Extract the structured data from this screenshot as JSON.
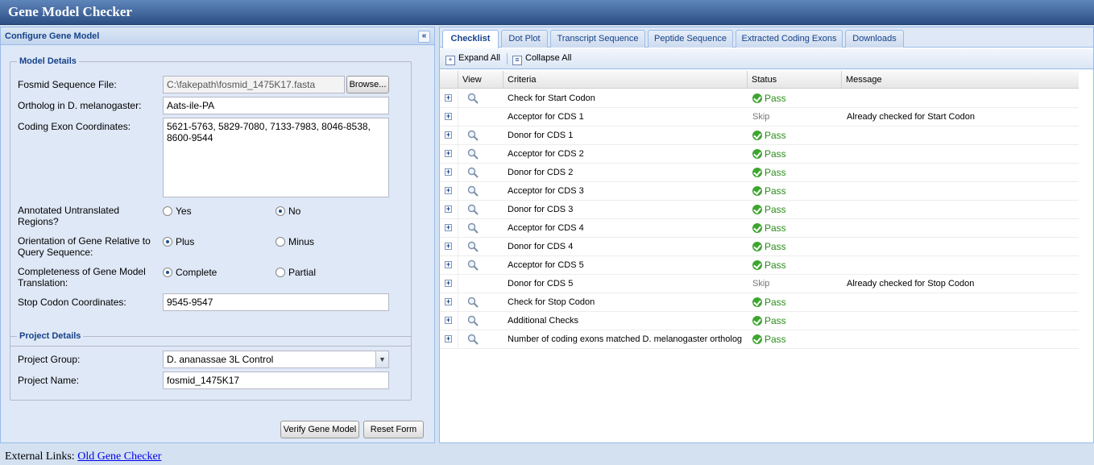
{
  "app": {
    "title": "Gene Model Checker"
  },
  "left": {
    "title": "Configure Gene Model",
    "collapse_glyph": "«",
    "model_details": {
      "legend": "Model Details",
      "fosmid_label": "Fosmid Sequence File:",
      "fosmid_value": "C:\\fakepath\\fosmid_1475K17.fasta",
      "browse_label": "Browse...",
      "ortholog_label": "Ortholog in D. melanogaster:",
      "ortholog_value": "Aats-ile-PA",
      "coords_label": "Coding Exon Coordinates:",
      "coords_value": "5621-5763, 5829-7080, 7133-7983, 8046-8538, 8600-9544",
      "utr_label": "Annotated Untranslated Regions?",
      "utr_yes": "Yes",
      "utr_no": "No",
      "orient_label": "Orientation of Gene Relative to Query Sequence:",
      "orient_plus": "Plus",
      "orient_minus": "Minus",
      "complete_label": "Completeness of Gene Model Translation:",
      "complete_complete": "Complete",
      "complete_partial": "Partial",
      "stop_label": "Stop Codon Coordinates:",
      "stop_value": "9545-9547"
    },
    "project_details": {
      "legend": "Project Details",
      "group_label": "Project Group:",
      "group_value": "D. ananassae 3L Control",
      "name_label": "Project Name:",
      "name_value": "fosmid_1475K17"
    },
    "verify_label": "Verify Gene Model",
    "reset_label": "Reset Form"
  },
  "footer": {
    "prefix": "External Links:",
    "link": "Old Gene Checker"
  },
  "right": {
    "tabs": [
      "Checklist",
      "Dot Plot",
      "Transcript Sequence",
      "Peptide Sequence",
      "Extracted Coding Exons",
      "Downloads"
    ],
    "expand_all": "Expand All",
    "collapse_all": "Collapse All",
    "columns": [
      "View",
      "Criteria",
      "Status",
      "Message"
    ],
    "rows": [
      {
        "criteria": "Check for Start Codon",
        "status": "Pass",
        "message": "",
        "view": true
      },
      {
        "criteria": "Acceptor for CDS 1",
        "status": "Skip",
        "message": "Already checked for Start Codon",
        "view": false
      },
      {
        "criteria": "Donor for CDS 1",
        "status": "Pass",
        "message": "",
        "view": true
      },
      {
        "criteria": "Acceptor for CDS 2",
        "status": "Pass",
        "message": "",
        "view": true
      },
      {
        "criteria": "Donor for CDS 2",
        "status": "Pass",
        "message": "",
        "view": true
      },
      {
        "criteria": "Acceptor for CDS 3",
        "status": "Pass",
        "message": "",
        "view": true
      },
      {
        "criteria": "Donor for CDS 3",
        "status": "Pass",
        "message": "",
        "view": true
      },
      {
        "criteria": "Acceptor for CDS 4",
        "status": "Pass",
        "message": "",
        "view": true
      },
      {
        "criteria": "Donor for CDS 4",
        "status": "Pass",
        "message": "",
        "view": true
      },
      {
        "criteria": "Acceptor for CDS 5",
        "status": "Pass",
        "message": "",
        "view": true
      },
      {
        "criteria": "Donor for CDS 5",
        "status": "Skip",
        "message": "Already checked for Stop Codon",
        "view": false
      },
      {
        "criteria": "Check for Stop Codon",
        "status": "Pass",
        "message": "",
        "view": true
      },
      {
        "criteria": "Additional Checks",
        "status": "Pass",
        "message": "",
        "view": true
      },
      {
        "criteria": "Number of coding exons matched D. melanogaster ortholog",
        "status": "Pass",
        "message": "",
        "view": true
      }
    ]
  }
}
